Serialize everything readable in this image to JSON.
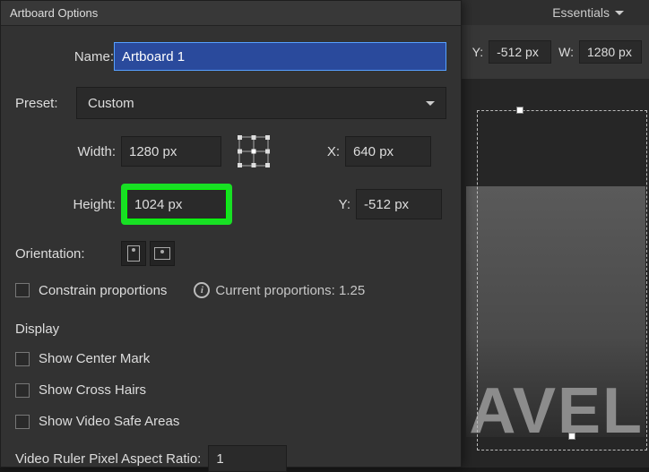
{
  "top": {
    "workspace_label": "Essentials"
  },
  "props": {
    "y_label": "Y:",
    "y_value": "-512 px",
    "w_label": "W:",
    "w_value": "1280 px"
  },
  "canvas": {
    "big_text": "AVEL"
  },
  "dialog": {
    "title": "Artboard Options",
    "name_label": "Name:",
    "name_value": "Artboard 1",
    "preset_label": "Preset:",
    "preset_value": "Custom",
    "width_label": "Width:",
    "width_value": "1280 px",
    "height_label": "Height:",
    "height_value": "1024 px",
    "x_label": "X:",
    "x_value": "640 px",
    "y_label": "Y:",
    "y_value": "-512 px",
    "orientation_label": "Orientation:",
    "constrain_label": "Constrain proportions",
    "proportions_label": "Current proportions: 1.25",
    "display_label": "Display",
    "show_center_label": "Show Center Mark",
    "show_cross_label": "Show Cross Hairs",
    "show_video_label": "Show Video Safe Areas",
    "video_ruler_label": "Video Ruler Pixel Aspect Ratio:",
    "video_ruler_value": "1"
  }
}
